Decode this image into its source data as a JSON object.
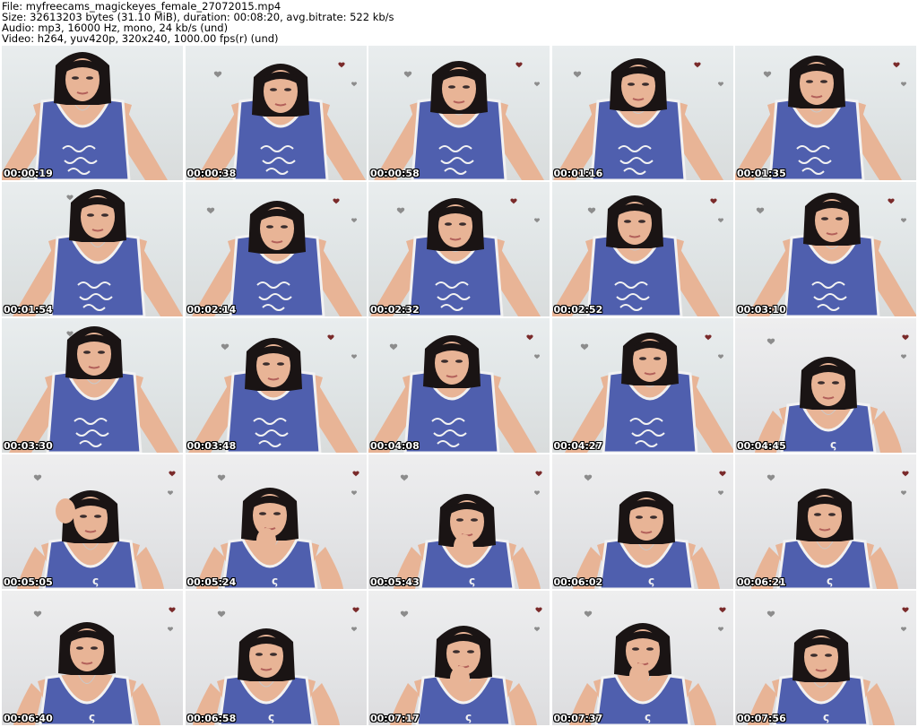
{
  "header": {
    "line1": "File: myfreecams_magickeyes_female_27072015.mp4",
    "line2": "Size: 32613203 bytes (31.10 MiB), duration: 00:08:20, avg.bitrate: 522 kb/s",
    "line3": "Audio: mp3, 16000 Hz, mono, 24 kb/s (und)",
    "line4": "Video: h264, yuv420p, 320x240, 1000.00 fps(r) (und)"
  },
  "thumbnails": [
    {
      "timestamp": "00:00:19"
    },
    {
      "timestamp": "00:00:38"
    },
    {
      "timestamp": "00:00:58"
    },
    {
      "timestamp": "00:01:16"
    },
    {
      "timestamp": "00:01:35"
    },
    {
      "timestamp": "00:01:54"
    },
    {
      "timestamp": "00:02:14"
    },
    {
      "timestamp": "00:02:32"
    },
    {
      "timestamp": "00:02:52"
    },
    {
      "timestamp": "00:03:10"
    },
    {
      "timestamp": "00:03:30"
    },
    {
      "timestamp": "00:03:48"
    },
    {
      "timestamp": "00:04:08"
    },
    {
      "timestamp": "00:04:27"
    },
    {
      "timestamp": "00:04:45"
    },
    {
      "timestamp": "00:05:05"
    },
    {
      "timestamp": "00:05:24"
    },
    {
      "timestamp": "00:05:43"
    },
    {
      "timestamp": "00:06:02"
    },
    {
      "timestamp": "00:06:21"
    },
    {
      "timestamp": "00:06:40"
    },
    {
      "timestamp": "00:06:58"
    },
    {
      "timestamp": "00:07:17"
    },
    {
      "timestamp": "00:07:37"
    },
    {
      "timestamp": "00:07:56"
    }
  ],
  "colors": {
    "shirt": "#4f5fae",
    "shirt_trim": "#f2f2f2",
    "hair": "#1a1414",
    "skin": "#e8b496",
    "heart_red": "#7a2a2a",
    "heart_gray": "#8c8c8c",
    "timestamp_text": "#ffffff"
  }
}
